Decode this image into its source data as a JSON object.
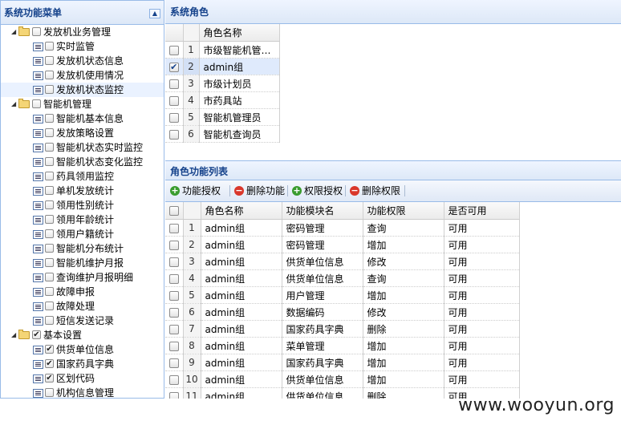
{
  "sidebar": {
    "title": "系统功能菜单",
    "tree": [
      {
        "type": "group",
        "label": "发放机业务管理",
        "checked": false
      },
      {
        "type": "leaf",
        "label": "实时监管",
        "checked": false
      },
      {
        "type": "leaf",
        "label": "发放机状态信息",
        "checked": false
      },
      {
        "type": "leaf",
        "label": "发放机使用情况",
        "checked": false
      },
      {
        "type": "leaf",
        "label": "发放机状态监控",
        "checked": false
      },
      {
        "type": "group",
        "label": "智能机管理",
        "checked": false
      },
      {
        "type": "leaf",
        "label": "智能机基本信息",
        "checked": false
      },
      {
        "type": "leaf",
        "label": "发放策略设置",
        "checked": false
      },
      {
        "type": "leaf",
        "label": "智能机状态实时监控",
        "checked": false
      },
      {
        "type": "leaf",
        "label": "智能机状态变化监控",
        "checked": false
      },
      {
        "type": "leaf",
        "label": "药具领用监控",
        "checked": false
      },
      {
        "type": "leaf",
        "label": "单机发放统计",
        "checked": false
      },
      {
        "type": "leaf",
        "label": "领用性别统计",
        "checked": false
      },
      {
        "type": "leaf",
        "label": "领用年龄统计",
        "checked": false
      },
      {
        "type": "leaf",
        "label": "领用户籍统计",
        "checked": false
      },
      {
        "type": "leaf",
        "label": "智能机分布统计",
        "checked": false
      },
      {
        "type": "leaf",
        "label": "智能机维护月报",
        "checked": false
      },
      {
        "type": "leaf",
        "label": "查询维护月报明细",
        "checked": false
      },
      {
        "type": "leaf",
        "label": "故障申报",
        "checked": false
      },
      {
        "type": "leaf",
        "label": "故障处理",
        "checked": false
      },
      {
        "type": "leaf",
        "label": "短信发送记录",
        "checked": false
      },
      {
        "type": "group",
        "label": "基本设置",
        "checked": true
      },
      {
        "type": "leaf",
        "label": "供货单位信息",
        "checked": true
      },
      {
        "type": "leaf",
        "label": "国家药具字典",
        "checked": true
      },
      {
        "type": "leaf",
        "label": "区划代码",
        "checked": true
      },
      {
        "type": "leaf",
        "label": "机构信息管理",
        "checked": false
      }
    ]
  },
  "roles": {
    "title": "系统角色",
    "column": "角色名称",
    "rows": [
      {
        "n": "1",
        "name": "市级智能机管理员",
        "checked": false
      },
      {
        "n": "2",
        "name": "admin组",
        "checked": true
      },
      {
        "n": "3",
        "name": "市级计划员",
        "checked": false
      },
      {
        "n": "4",
        "name": "市药具站",
        "checked": false
      },
      {
        "n": "5",
        "name": "智能机管理员",
        "checked": false
      },
      {
        "n": "6",
        "name": "智能机查询员",
        "checked": false
      }
    ]
  },
  "funcs": {
    "title": "角色功能列表",
    "toolbar": {
      "grant_func": "功能授权",
      "delete_func": "删除功能",
      "grant_perm": "权限授权",
      "delete_perm": "删除权限"
    },
    "columns": [
      "角色名称",
      "功能模块名",
      "功能权限",
      "是否可用"
    ],
    "rows": [
      {
        "n": "1",
        "role": "admin组",
        "module": "密码管理",
        "perm": "查询",
        "enabled": "可用"
      },
      {
        "n": "2",
        "role": "admin组",
        "module": "密码管理",
        "perm": "增加",
        "enabled": "可用"
      },
      {
        "n": "3",
        "role": "admin组",
        "module": "供货单位信息",
        "perm": "修改",
        "enabled": "可用"
      },
      {
        "n": "4",
        "role": "admin组",
        "module": "供货单位信息",
        "perm": "查询",
        "enabled": "可用"
      },
      {
        "n": "5",
        "role": "admin组",
        "module": "用户管理",
        "perm": "增加",
        "enabled": "可用"
      },
      {
        "n": "6",
        "role": "admin组",
        "module": "数据编码",
        "perm": "修改",
        "enabled": "可用"
      },
      {
        "n": "7",
        "role": "admin组",
        "module": "国家药具字典",
        "perm": "删除",
        "enabled": "可用"
      },
      {
        "n": "8",
        "role": "admin组",
        "module": "菜单管理",
        "perm": "增加",
        "enabled": "可用"
      },
      {
        "n": "9",
        "role": "admin组",
        "module": "国家药具字典",
        "perm": "增加",
        "enabled": "可用"
      },
      {
        "n": "10",
        "role": "admin组",
        "module": "供货单位信息",
        "perm": "增加",
        "enabled": "可用"
      },
      {
        "n": "11",
        "role": "admin组",
        "module": "供货单位信息",
        "perm": "删除",
        "enabled": "可用"
      }
    ]
  },
  "watermark": "www.wooyun.org"
}
